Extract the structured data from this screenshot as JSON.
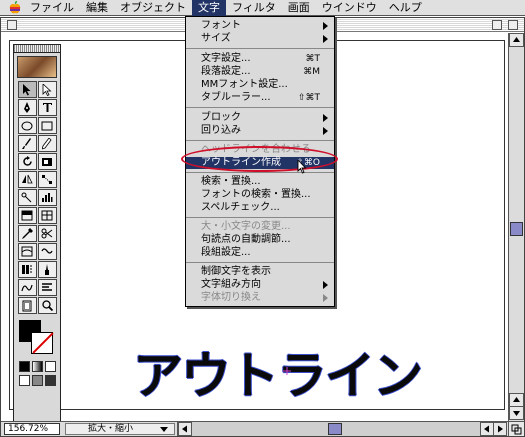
{
  "menubar": {
    "items": [
      {
        "label": "ファイル"
      },
      {
        "label": "編集"
      },
      {
        "label": "オブジェクト"
      },
      {
        "label": "文字",
        "active": true
      },
      {
        "label": "フィルタ"
      },
      {
        "label": "画面"
      },
      {
        "label": "ウインドウ"
      },
      {
        "label": "ヘルプ"
      }
    ]
  },
  "text_menu": {
    "items": [
      {
        "label": "フォント",
        "submenu": true
      },
      {
        "label": "サイズ",
        "submenu": true
      },
      {
        "label": "文字設定...",
        "shortcut": "⌘T"
      },
      {
        "label": "段落設定...",
        "shortcut": "⌘M"
      },
      {
        "label": "MMフォント設定..."
      },
      {
        "label": "タブルーラー...",
        "shortcut": "⇧⌘T"
      },
      {
        "label": "ブロック",
        "submenu": true
      },
      {
        "label": "回り込み",
        "submenu": true
      },
      {
        "label": "ヘッドラインを合わせる",
        "disabled": true
      },
      {
        "label": "アウトライン作成",
        "shortcut": "⇧⌘O",
        "highlighted": true
      },
      {
        "label": "検索・置換..."
      },
      {
        "label": "フォントの検索・置換..."
      },
      {
        "label": "スペルチェック..."
      },
      {
        "label": "大・小文字の変更...",
        "disabled": true
      },
      {
        "label": "句読点の自動調節..."
      },
      {
        "label": "段組設定..."
      },
      {
        "label": "制御文字を表示"
      },
      {
        "label": "文字組み方向",
        "submenu": true
      },
      {
        "label": "字体切り換え",
        "submenu": true,
        "disabled": true
      }
    ]
  },
  "canvas": {
    "outline_text": "アウトライン"
  },
  "statusbar": {
    "zoom": "156.72%",
    "status": "拡大・縮小"
  },
  "colors": {
    "highlight": "#223366",
    "annotation": "#d0102a",
    "anchor": "#3a4dcc"
  }
}
